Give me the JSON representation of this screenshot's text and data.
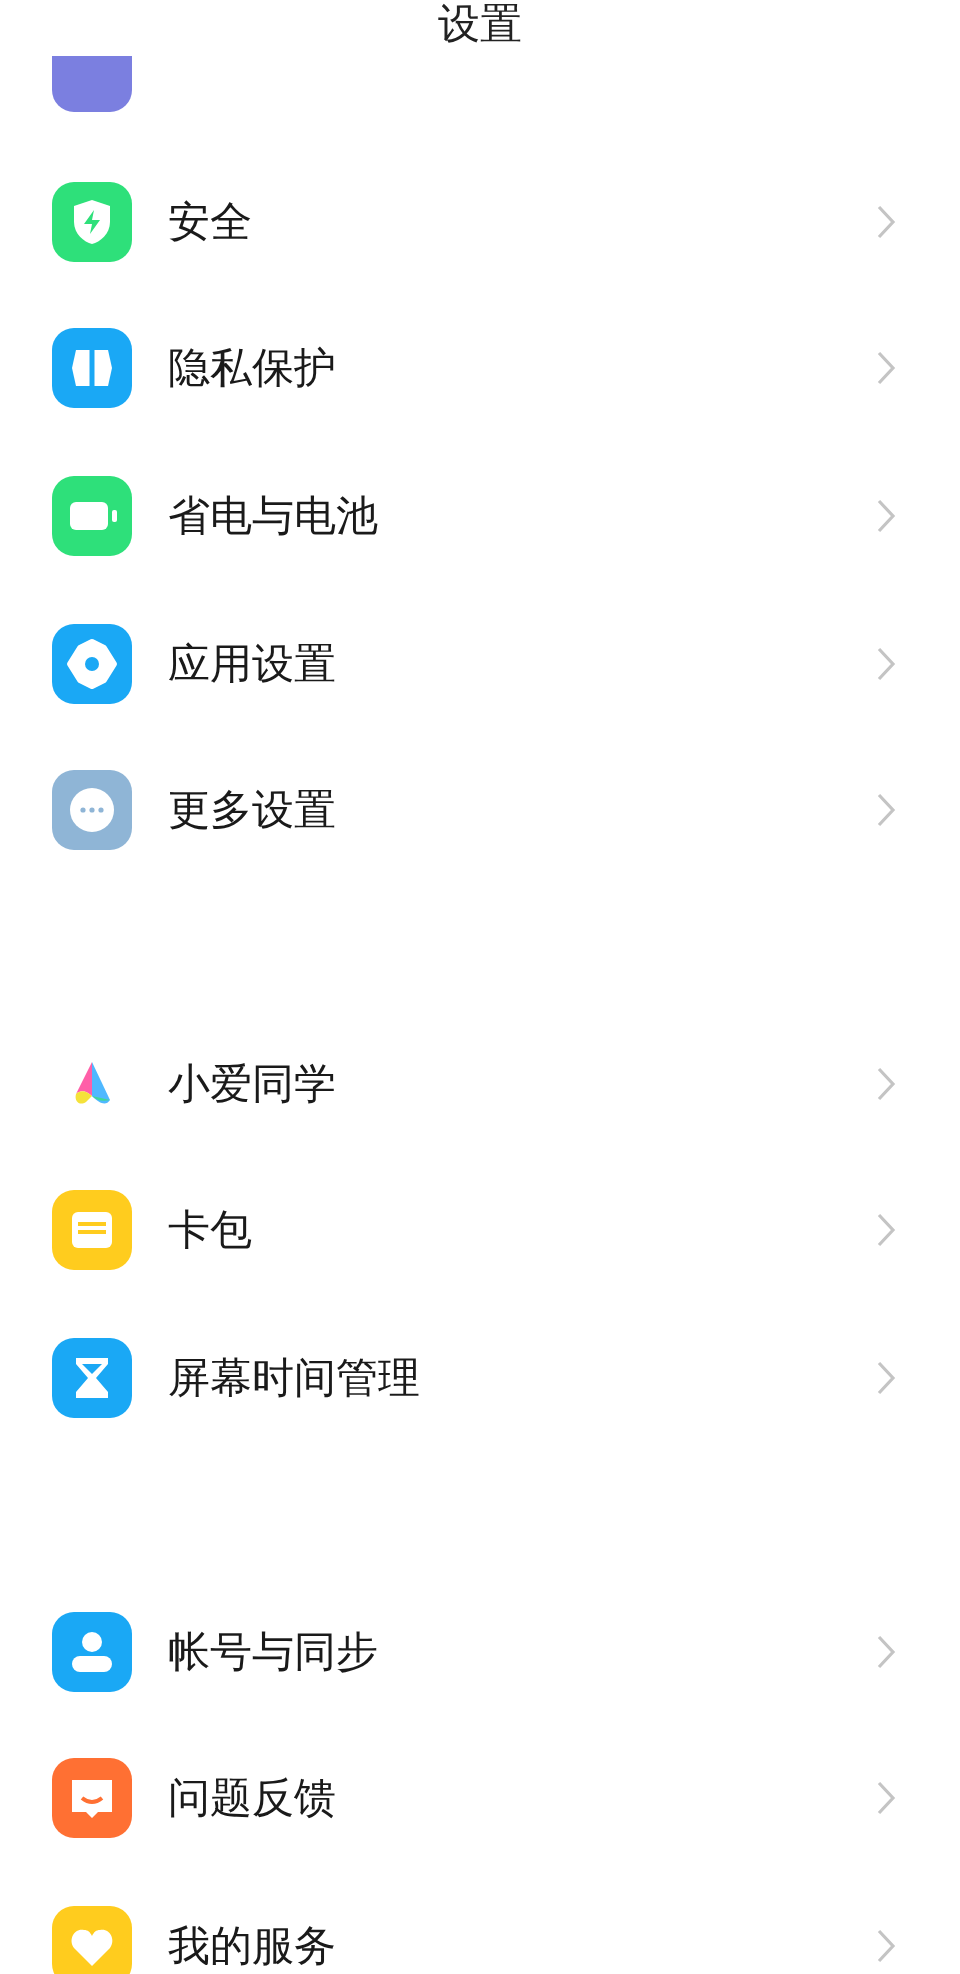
{
  "title": "设置",
  "groups": [
    {
      "items": [
        {
          "label": "安全",
          "kind": "shield",
          "color": "#2ee07a"
        },
        {
          "label": "隐私保护",
          "kind": "privacy",
          "color": "#1aa8f5"
        },
        {
          "label": "省电与电池",
          "kind": "battery",
          "color": "#2ee07a"
        },
        {
          "label": "应用设置",
          "kind": "gear",
          "color": "#1aa8f5"
        },
        {
          "label": "更多设置",
          "kind": "more",
          "color": "#8fb5d6"
        }
      ]
    },
    {
      "items": [
        {
          "label": "小爱同学",
          "kind": "assistant"
        },
        {
          "label": "卡包",
          "kind": "wallet",
          "color": "#ffcc1e"
        },
        {
          "label": "屏幕时间管理",
          "kind": "hourglass",
          "color": "#1aa8f5"
        }
      ]
    },
    {
      "items": [
        {
          "label": "帐号与同步",
          "kind": "person",
          "color": "#1aa8f5"
        },
        {
          "label": "问题反馈",
          "kind": "feedback",
          "color": "#ff7033"
        },
        {
          "label": "我的服务",
          "kind": "heart",
          "color": "#ffcc1e"
        }
      ]
    }
  ]
}
